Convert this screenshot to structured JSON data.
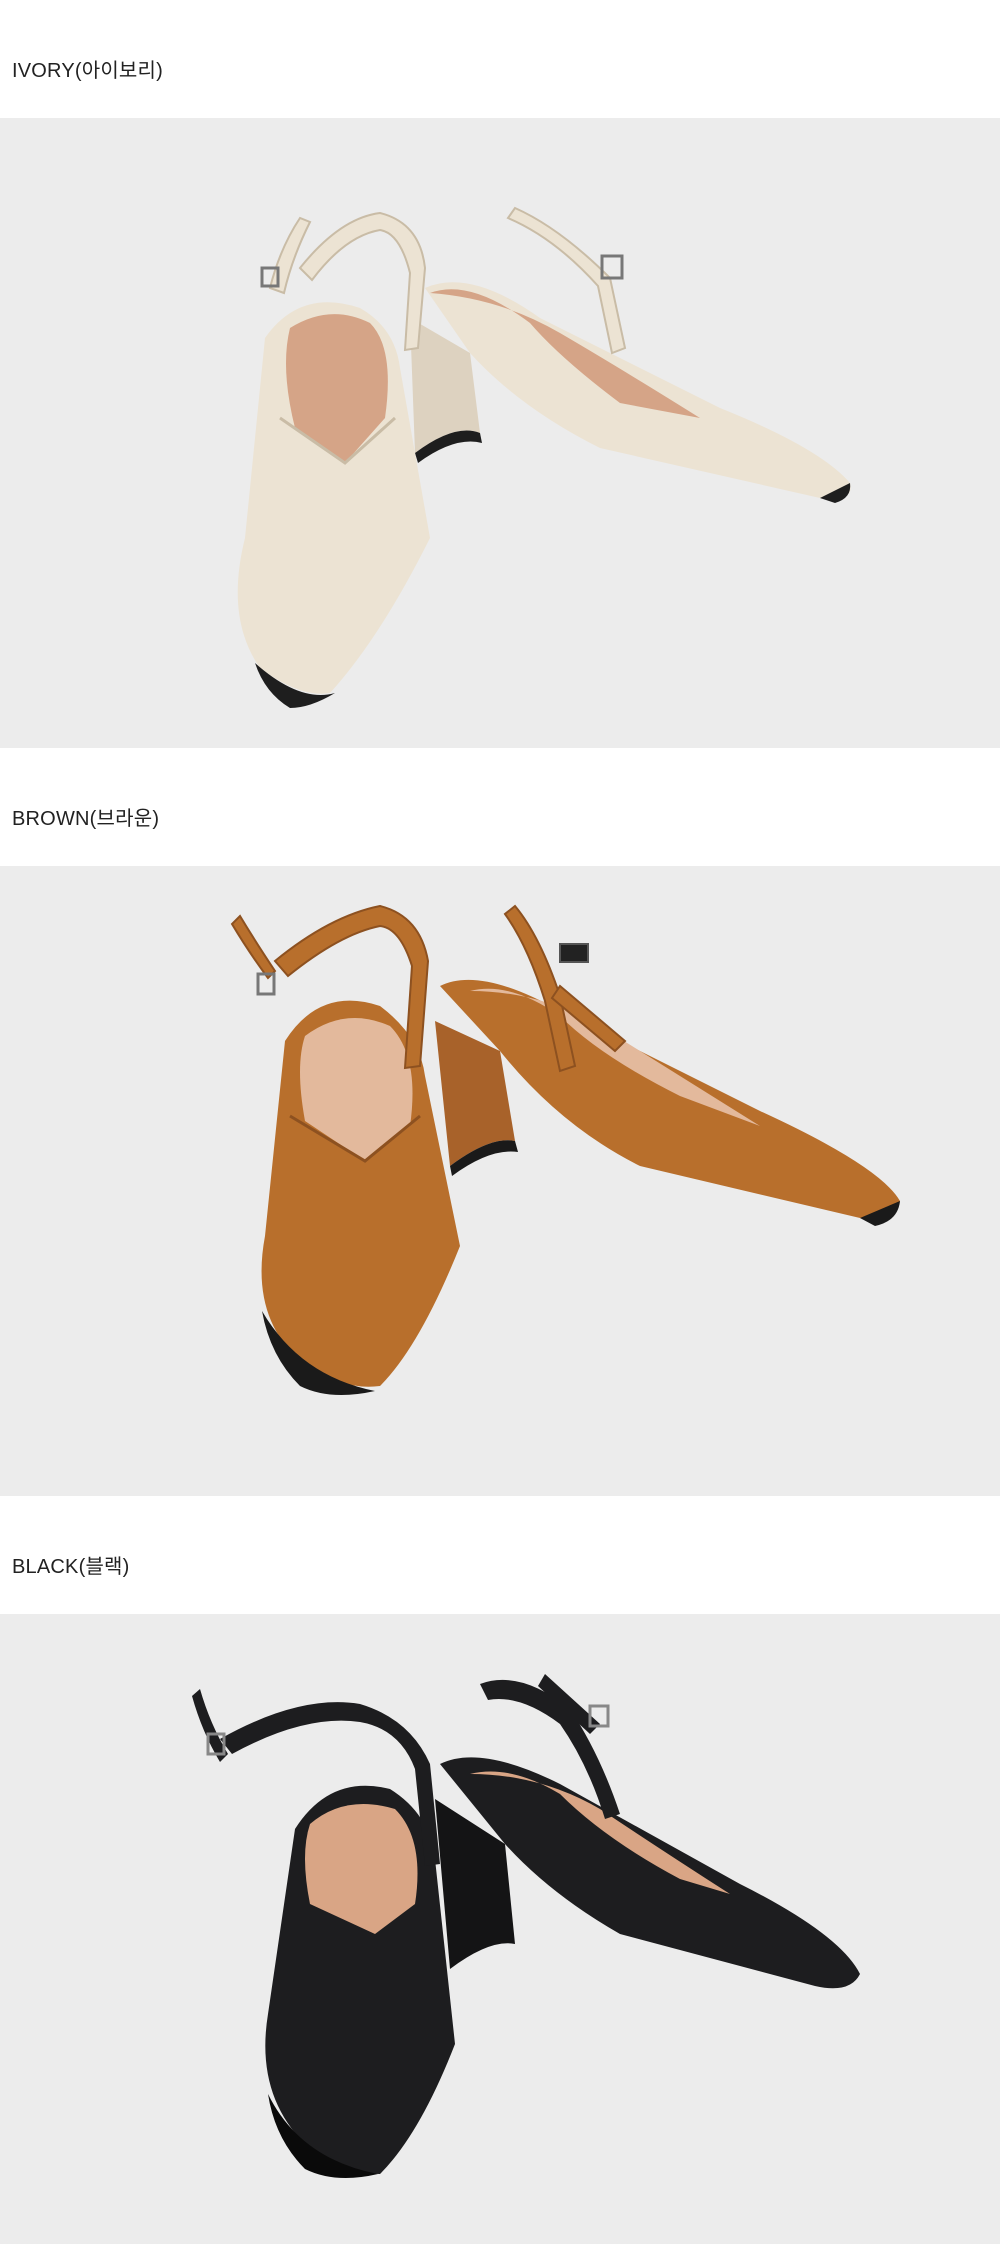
{
  "variants": [
    {
      "label": "IVORY(아이보리)",
      "color": "#ece3d3",
      "shade": "#c9bca6",
      "lining": "#d5a487",
      "sole": "#1e1e1e"
    },
    {
      "label": "BROWN(브라운)",
      "color": "#b86f2c",
      "shade": "#8d5120",
      "lining": "#e3b99c",
      "sole": "#1a1a1a"
    },
    {
      "label": "BLACK(블랙)",
      "color": "#1d1d1f",
      "shade": "#0c0c0d",
      "lining": "#d9a585",
      "sole": "#0a0a0a"
    }
  ],
  "background": "#ececec"
}
